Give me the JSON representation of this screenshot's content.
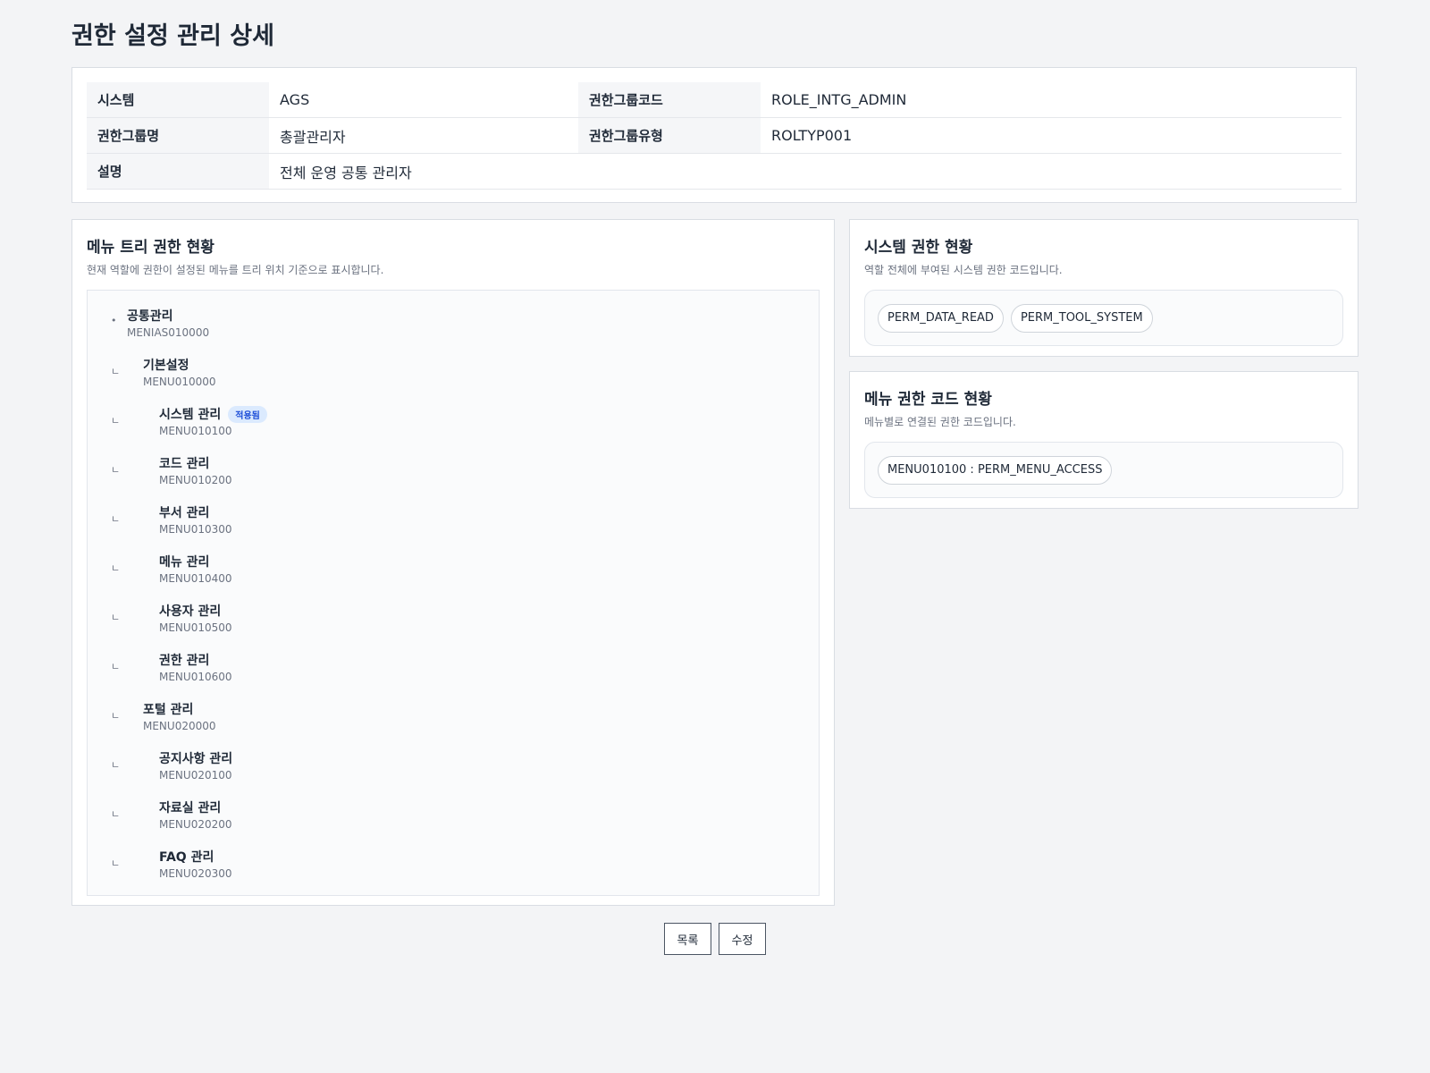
{
  "page": {
    "title": "권한 설정 관리 상세"
  },
  "info": {
    "rows": [
      [
        {
          "label": "시스템",
          "value": "AGS"
        },
        {
          "label": "권한그룹코드",
          "value": "ROLE_INTG_ADMIN"
        }
      ],
      [
        {
          "label": "권한그룹명",
          "value": "총괄관리자"
        },
        {
          "label": "권한그룹유형",
          "value": "ROLTYP001"
        }
      ],
      [
        {
          "label": "설명",
          "value": "전체 운영 공통 관리자"
        }
      ]
    ]
  },
  "menu_tree": {
    "title": "메뉴 트리 권한 현황",
    "description": "현재 역할에 권한이 설정된 메뉴를 트리 위치 기준으로 표시합니다.",
    "nodes": [
      {
        "marker": "•",
        "name": "공통관리",
        "code": "MENIAS010000",
        "level": 0,
        "badge": ""
      },
      {
        "marker": "ㄴ",
        "name": "기본설정",
        "code": "MENU010000",
        "level": 1,
        "badge": ""
      },
      {
        "marker": "ㄴ",
        "name": "시스템 관리",
        "code": "MENU010100",
        "level": 2,
        "badge": "적용됨"
      },
      {
        "marker": "ㄴ",
        "name": "코드 관리",
        "code": "MENU010200",
        "level": 2,
        "badge": ""
      },
      {
        "marker": "ㄴ",
        "name": "부서 관리",
        "code": "MENU010300",
        "level": 2,
        "badge": ""
      },
      {
        "marker": "ㄴ",
        "name": "메뉴 관리",
        "code": "MENU010400",
        "level": 2,
        "badge": ""
      },
      {
        "marker": "ㄴ",
        "name": "사용자 관리",
        "code": "MENU010500",
        "level": 2,
        "badge": ""
      },
      {
        "marker": "ㄴ",
        "name": "권한 관리",
        "code": "MENU010600",
        "level": 2,
        "badge": ""
      },
      {
        "marker": "ㄴ",
        "name": "포털 관리",
        "code": "MENU020000",
        "level": 1,
        "badge": ""
      },
      {
        "marker": "ㄴ",
        "name": "공지사항 관리",
        "code": "MENU020100",
        "level": 2,
        "badge": ""
      },
      {
        "marker": "ㄴ",
        "name": "자료실 관리",
        "code": "MENU020200",
        "level": 2,
        "badge": ""
      },
      {
        "marker": "ㄴ",
        "name": "FAQ 관리",
        "code": "MENU020300",
        "level": 2,
        "badge": ""
      }
    ]
  },
  "system_perm": {
    "title": "시스템 권한 현황",
    "description": "역할 전체에 부여된 시스템 권한 코드입니다.",
    "chips": [
      "PERM_DATA_READ",
      "PERM_TOOL_SYSTEM"
    ]
  },
  "menu_perm": {
    "title": "메뉴 권한 코드 현황",
    "description": "메뉴별로 연결된 권한 코드입니다.",
    "chips": [
      "MENU010100 : PERM_MENU_ACCESS"
    ]
  },
  "actions": {
    "list_label": "목록",
    "edit_label": "수정"
  }
}
